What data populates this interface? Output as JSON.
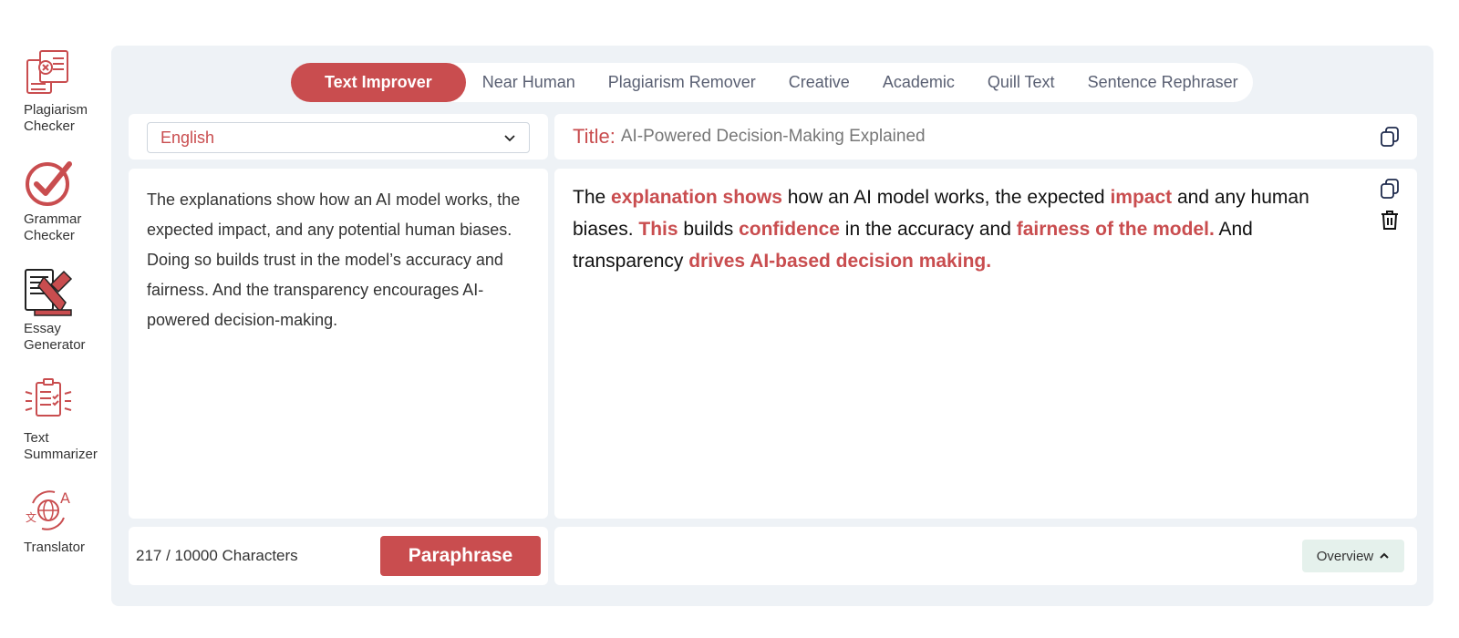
{
  "sidebar": {
    "items": [
      {
        "label": "Plagiarism Checker",
        "icon": "plagiarism-checker-icon"
      },
      {
        "label": "Grammar Checker",
        "icon": "grammar-checker-icon"
      },
      {
        "label": "Essay Generator",
        "icon": "essay-generator-icon"
      },
      {
        "label": "Text Summarizer",
        "icon": "text-summarizer-icon"
      },
      {
        "label": "Translator",
        "icon": "translator-icon"
      }
    ]
  },
  "tabs": [
    {
      "label": "Text Improver",
      "active": true
    },
    {
      "label": "Near Human",
      "active": false
    },
    {
      "label": "Plagiarism Remover",
      "active": false
    },
    {
      "label": "Creative",
      "active": false
    },
    {
      "label": "Academic",
      "active": false
    },
    {
      "label": "Quill Text",
      "active": false
    },
    {
      "label": "Sentence Rephraser",
      "active": false
    }
  ],
  "language": {
    "selected": "English"
  },
  "title": {
    "label": "Title:",
    "text": "AI-Powered Decision-Making Explained"
  },
  "input": {
    "text": "The explanations show how an AI model works, the expected impact, and any potential human biases. Doing so builds trust in the model’s accuracy and fairness. And the transparency encourages AI-powered decision-making."
  },
  "output": {
    "segments": [
      {
        "text": "The ",
        "changed": false
      },
      {
        "text": "explanation shows",
        "changed": true
      },
      {
        "text": " how an AI model works, the expected ",
        "changed": false
      },
      {
        "text": "impact",
        "changed": true
      },
      {
        "text": " and any human biases. ",
        "changed": false
      },
      {
        "text": "This",
        "changed": true
      },
      {
        "text": " builds ",
        "changed": false
      },
      {
        "text": "confidence",
        "changed": true
      },
      {
        "text": " in the accuracy and ",
        "changed": false
      },
      {
        "text": "fairness of the model.",
        "changed": true
      },
      {
        "text": " And transparency ",
        "changed": false
      },
      {
        "text": "drives AI-based decision making.",
        "changed": true
      }
    ]
  },
  "footer": {
    "char_count": "217 / 10000 Characters",
    "paraphrase_label": "Paraphrase",
    "overview_label": "Overview"
  },
  "colors": {
    "accent": "#c94d4f",
    "panel": "#eef2f6",
    "overview_bg": "#e5f1ec"
  }
}
